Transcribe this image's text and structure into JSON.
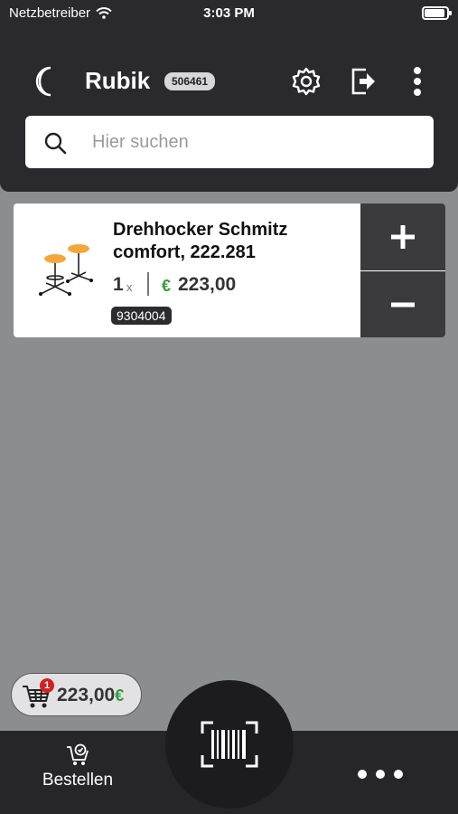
{
  "status_bar": {
    "carrier": "Netzbetreiber",
    "time": "3:03 PM",
    "battery_level": 0.92
  },
  "header": {
    "title": "Rubik",
    "customer_id": "506461"
  },
  "icons": {
    "moon": "moon-icon",
    "settings": "gear-icon",
    "logout": "logout-icon",
    "menu": "more-vertical-icon",
    "search": "search-icon",
    "cart": "cart-icon",
    "order": "order-cart-icon",
    "scan": "barcode-scan-icon",
    "more": "more-horizontal-icon"
  },
  "search": {
    "placeholder": "Hier suchen",
    "value": ""
  },
  "cart_items": [
    {
      "name": "Drehhocker Schmitz comfort, 222.281",
      "quantity": "1",
      "quantity_unit": "x",
      "currency": "€",
      "price": "223,00",
      "article_number": "9304004",
      "plus_label": "+",
      "minus_label": "−"
    }
  ],
  "cart_summary": {
    "count": "1",
    "total": "223,00",
    "currency": "€"
  },
  "bottom_nav": {
    "order_label": "Bestellen"
  },
  "colors": {
    "header": "#2a2a2c",
    "background": "#8c8d8f",
    "price_green": "#3a9a3a",
    "badge_red": "#d32020",
    "button_dark": "#3b3b3d"
  }
}
